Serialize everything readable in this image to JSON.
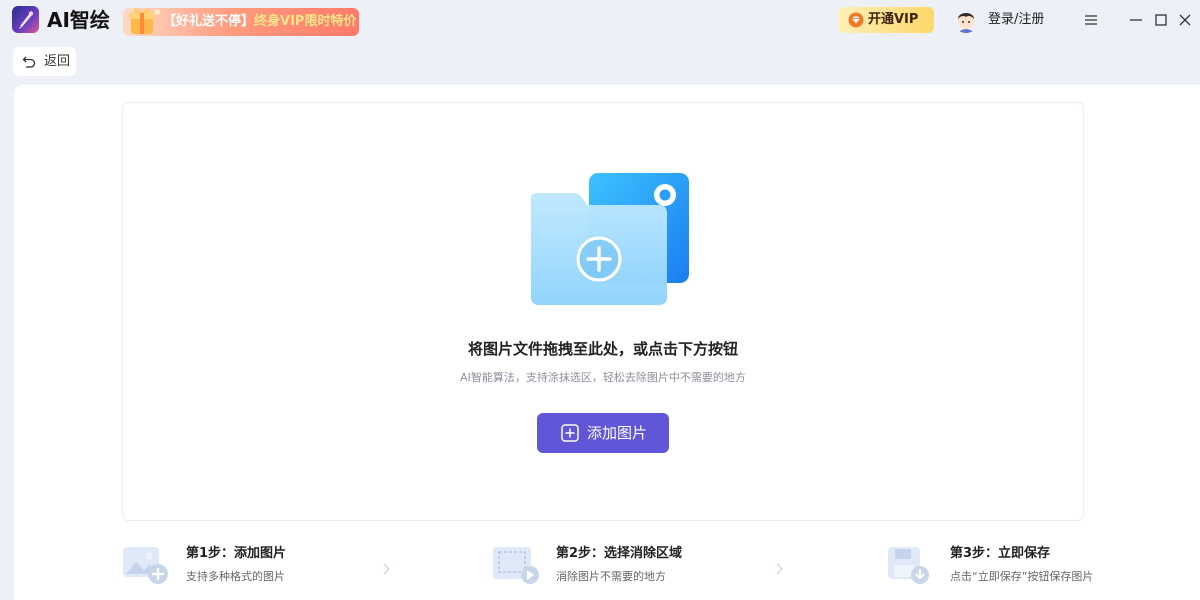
{
  "app": {
    "name": "AI智绘"
  },
  "promo": {
    "prefix": "【好礼送不停】",
    "highlight": "终身VIP限时特价"
  },
  "header": {
    "vip_label": "开通VIP",
    "login_label": "登录/注册"
  },
  "nav": {
    "back_label": "返回"
  },
  "drop_zone": {
    "title": "将图片文件拖拽至此处，或点击下方按钮",
    "subtitle": "AI智能算法，支持涂抹选区，轻松去除图片中不需要的地方",
    "add_button_label": "添加图片"
  },
  "steps": [
    {
      "title": "第1步：添加图片",
      "desc": "支持多种格式的图片"
    },
    {
      "title": "第2步：选择消除区域",
      "desc": "消除图片不需要的地方"
    },
    {
      "title": "第3步：立即保存",
      "desc": "点击“立即保存”按钮保存图片"
    }
  ],
  "colors": {
    "accent": "#5f57d8",
    "background": "#eef0f8",
    "panel": "#ffffff",
    "vip_gold": "#ffd76a",
    "promo_red": "#ff7a6a"
  },
  "icons": {
    "logo": "ai-draw-logo-icon",
    "gift": "gift-icon",
    "vip": "diamond-icon",
    "menu": "menu-icon",
    "minimize": "minimize-icon",
    "maximize": "maximize-icon",
    "close": "close-icon",
    "back": "undo-arrow-icon",
    "folder": "folder-add-icon",
    "add": "plus-square-icon"
  }
}
